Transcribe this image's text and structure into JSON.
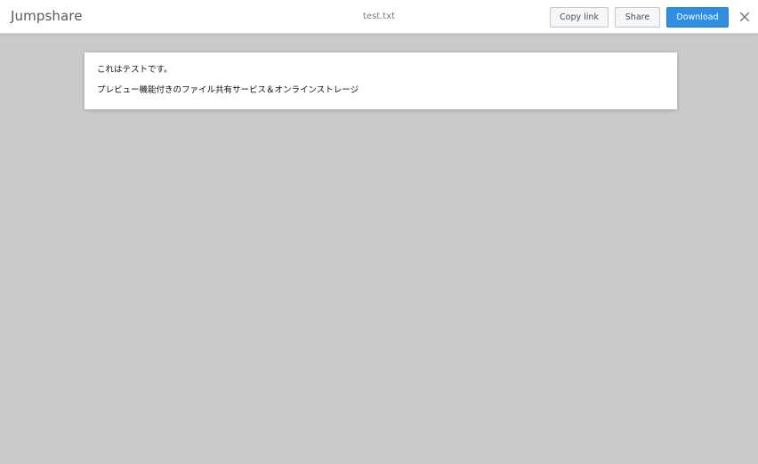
{
  "header": {
    "logo": "Jumpshare",
    "filename": "test.txt",
    "copy_link_label": "Copy link",
    "share_label": "Share",
    "download_label": "Download",
    "close_icon": "close-icon"
  },
  "document": {
    "lines": [
      "これはテストです。",
      "プレビュー機能付きのファイル共有サービス＆オンラインストレージ"
    ]
  },
  "colors": {
    "background": "#cbcbcb",
    "header_bg": "#ffffff",
    "accent": "#2e8ee2"
  }
}
